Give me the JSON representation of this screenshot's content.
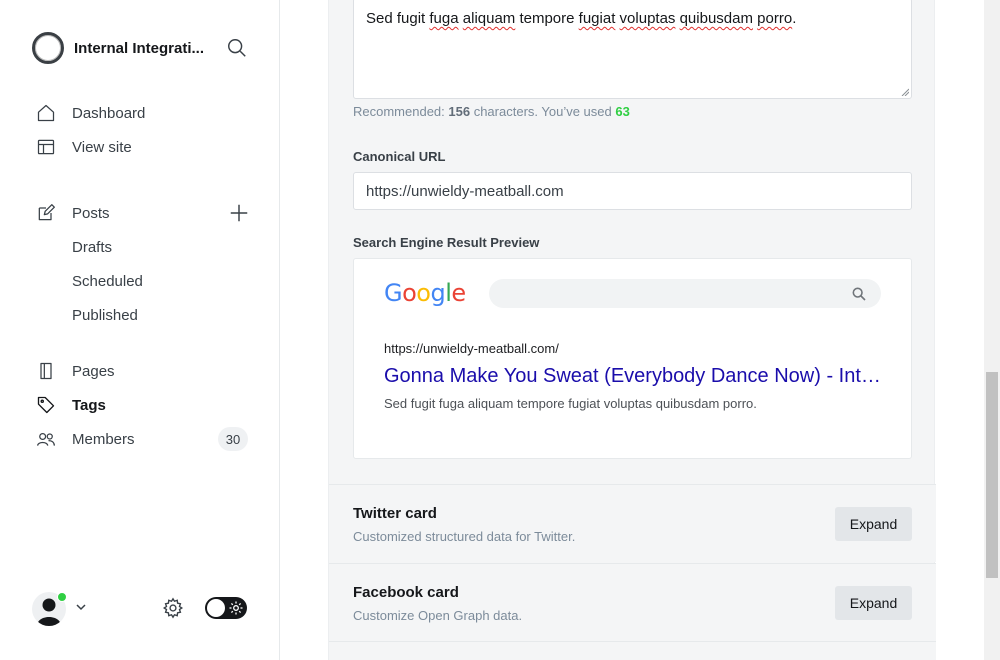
{
  "sidebar": {
    "site_title": "Internal Integrati...",
    "nav": [
      {
        "label": "Dashboard",
        "icon": "home-icon"
      },
      {
        "label": "View site",
        "icon": "layout-icon"
      },
      {
        "label": "Posts",
        "icon": "pencil-icon"
      },
      {
        "label": "Drafts"
      },
      {
        "label": "Scheduled"
      },
      {
        "label": "Published"
      },
      {
        "label": "Pages",
        "icon": "page-icon"
      },
      {
        "label": "Tags",
        "icon": "tag-icon"
      },
      {
        "label": "Members",
        "icon": "members-icon",
        "count": "30"
      }
    ]
  },
  "editor": {
    "meta_description": "Sed fugit fuga aliquam tempore fugiat voluptas quibusdam porro.",
    "hint": {
      "prefix": "Recommended: ",
      "recommended": "156",
      "middle": " characters. You’ve used ",
      "used": "63"
    },
    "canonical_label": "Canonical URL",
    "canonical_value": "https://unwieldy-meatball.com",
    "preview_label": "Search Engine Result Preview",
    "preview": {
      "logo": "Google",
      "url": "https://unwieldy-meatball.com/",
      "title": "Gonna Make You Sweat (Everybody Dance Now) - Internal Integrations",
      "description": "Sed fugit fuga aliquam tempore fugiat voluptas quibusdam porro."
    },
    "cards": [
      {
        "title": "Twitter card",
        "subtitle": "Customized structured data for Twitter.",
        "button": "Expand"
      },
      {
        "title": "Facebook card",
        "subtitle": "Customize Open Graph data.",
        "button": "Expand"
      }
    ]
  },
  "colors": {
    "accent_green": "#30cf43",
    "link_blue": "#1a0dab",
    "dark": "#15171a"
  }
}
